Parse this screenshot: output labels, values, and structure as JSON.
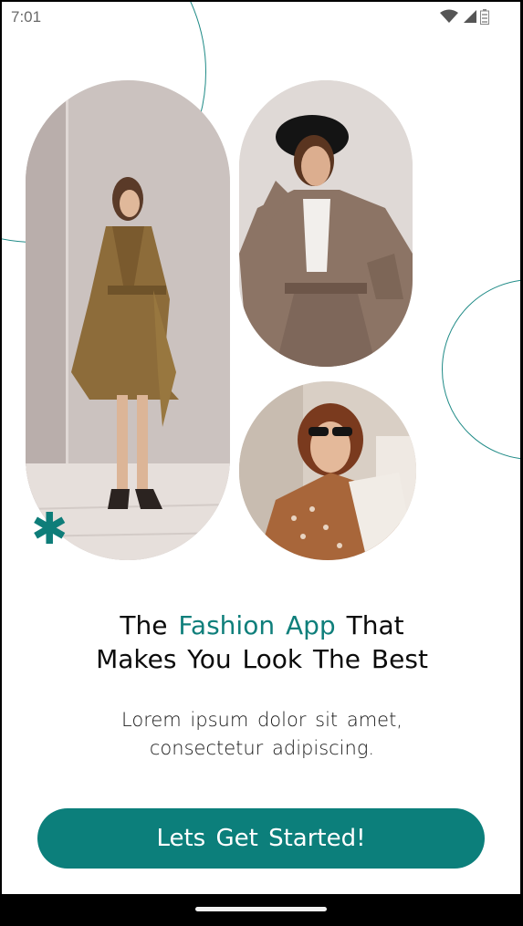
{
  "status_bar": {
    "time": "7:01",
    "icons": [
      "wifi-icon",
      "cellular-signal-icon",
      "battery-icon"
    ]
  },
  "hero": {
    "photos": [
      "woman-in-trench-coat-photo",
      "woman-in-hat-photo",
      "woman-in-sunglasses-photo"
    ],
    "decor_icon": "asterisk-icon"
  },
  "headline": {
    "line1_prefix": "The",
    "highlight": "Fashion App",
    "line1_suffix": "That",
    "line2": "Makes You Look The Best"
  },
  "subtitle": {
    "line1": "Lorem ipsum dolor sit amet,",
    "line2": "consectetur adipiscing."
  },
  "cta": {
    "label": "Lets Get Started!"
  },
  "colors": {
    "accent": "#0c7f7b",
    "text": "#0b0b0b",
    "background": "#ffffff"
  }
}
